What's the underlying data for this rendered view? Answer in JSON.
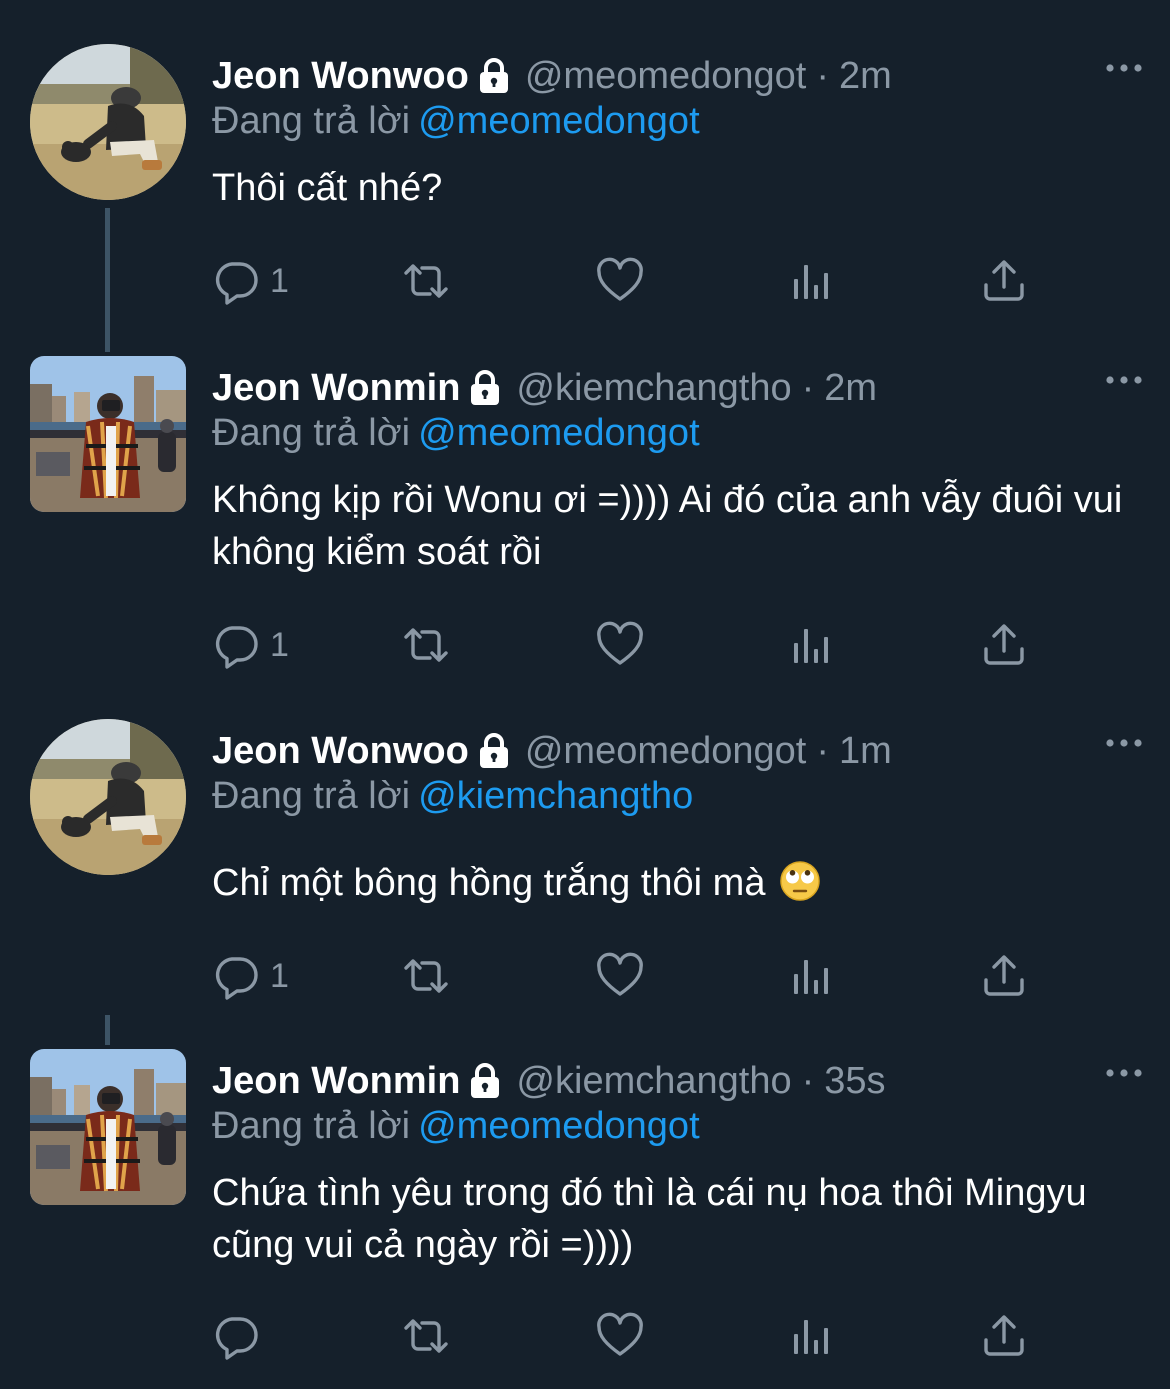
{
  "thread": [
    {
      "display_name": "Jeon Wonwoo",
      "handle": "@meomedongot",
      "dot": "·",
      "time": "2m",
      "reply_prefix": "Đang trả lời",
      "reply_to": "@meomedongot",
      "text": "Thôi cất nhé?",
      "reply_count": "1"
    },
    {
      "display_name": "Jeon Wonmin",
      "handle": "@kiemchangtho",
      "dot": "·",
      "time": "2m",
      "reply_prefix": "Đang trả lời",
      "reply_to": "@meomedongot",
      "text": "Không kịp rồi Wonu ơi =)))) Ai đó của anh vẫy đuôi vui không kiểm soát rồi",
      "reply_count": "1"
    },
    {
      "display_name": "Jeon Wonwoo",
      "handle": "@meomedongot",
      "dot": "·",
      "time": "1m",
      "reply_prefix": "Đang trả lời",
      "reply_to": "@kiemchangtho",
      "text": "Chỉ một bông hồng trắng thôi mà",
      "reply_count": "1"
    },
    {
      "display_name": "Jeon Wonmin",
      "handle": "@kiemchangtho",
      "dot": "·",
      "time": "35s",
      "reply_prefix": "Đang trả lời",
      "reply_to": "@meomedongot",
      "text": "Chứa tình yêu trong đó thì là cái nụ hoa thôi Mingyu cũng vui cả ngày rồi =))))",
      "reply_count": ""
    }
  ],
  "icons": {
    "lock": "lock-icon",
    "more": "more-dots-icon",
    "reply": "reply-bubble-icon",
    "retweet": "retweet-icon",
    "like": "heart-icon",
    "analytics": "analytics-icon",
    "share": "share-icon",
    "emoji": "face-with-rolling-eyes-emoji"
  },
  "colors": {
    "background": "#15202b",
    "secondary_text": "#8b98a5",
    "link": "#1d9bf0",
    "thread_line": "#3d5466"
  }
}
